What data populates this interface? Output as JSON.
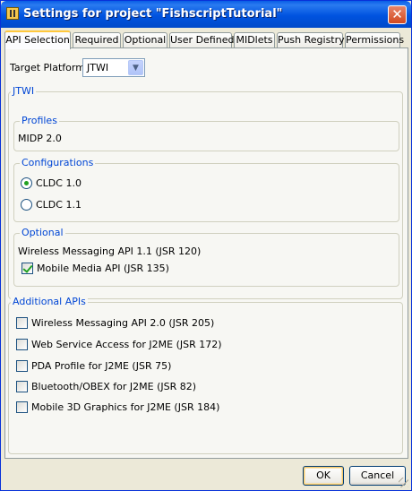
{
  "window": {
    "title": "Settings for project \"FishscriptTutorial\"",
    "close_label": "✕"
  },
  "tabs": [
    {
      "label": "API Selection",
      "active": true
    },
    {
      "label": "Required"
    },
    {
      "label": "Optional"
    },
    {
      "label": "User Defined"
    },
    {
      "label": "MIDlets"
    },
    {
      "label": "Push Registry"
    },
    {
      "label": "Permissions"
    }
  ],
  "target_platform": {
    "label": "Target Platform",
    "value": "JTWI"
  },
  "jtwi_group": {
    "legend": "JTWI",
    "profiles": {
      "legend": "Profiles",
      "value": "MIDP 2.0"
    },
    "configurations": {
      "legend": "Configurations",
      "options": [
        {
          "label": "CLDC 1.0",
          "selected": true
        },
        {
          "label": "CLDC 1.1",
          "selected": false
        }
      ]
    },
    "optional": {
      "legend": "Optional",
      "static_text": "Wireless Messaging API 1.1 (JSR 120)",
      "checkbox": {
        "label": "Mobile Media API (JSR 135)",
        "checked": true
      }
    }
  },
  "additional_apis": {
    "legend": "Additional APIs",
    "items": [
      {
        "label": "Wireless Messaging API 2.0 (JSR 205)",
        "checked": false
      },
      {
        "label": "Web Service Access for J2ME (JSR 172)",
        "checked": false
      },
      {
        "label": "PDA Profile for J2ME (JSR 75)",
        "checked": false
      },
      {
        "label": "Bluetooth/OBEX for J2ME (JSR 82)",
        "checked": false
      },
      {
        "label": "Mobile 3D Graphics for J2ME (JSR 184)",
        "checked": false
      }
    ]
  },
  "buttons": {
    "ok": "OK",
    "cancel": "Cancel"
  }
}
